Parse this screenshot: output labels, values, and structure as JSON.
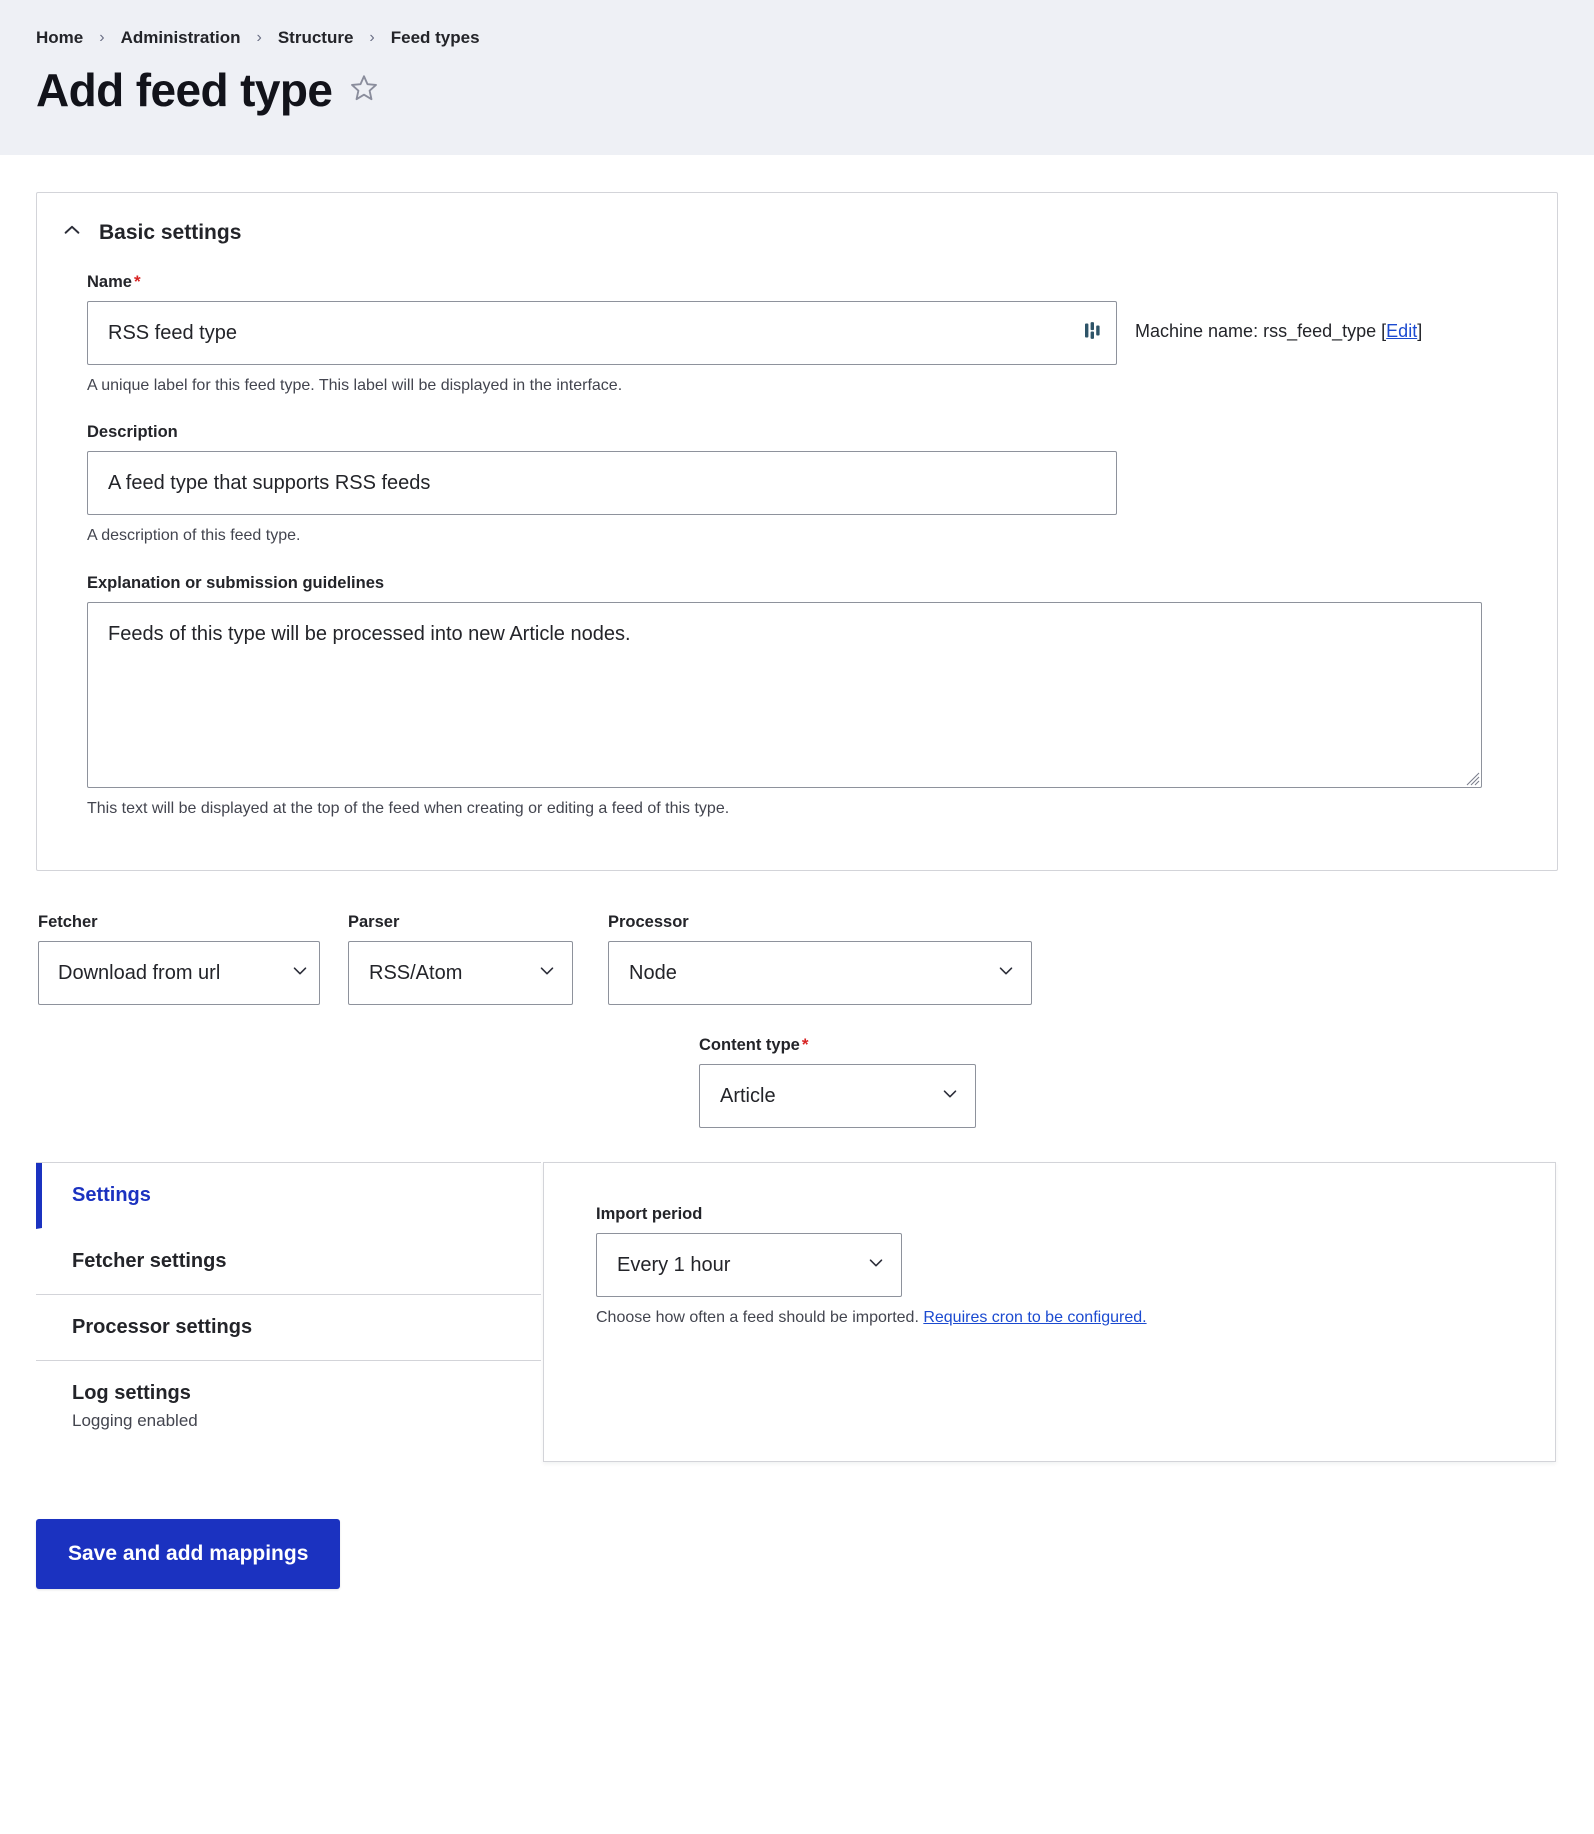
{
  "header": {
    "breadcrumb": [
      {
        "label": "Home"
      },
      {
        "label": "Administration"
      },
      {
        "label": "Structure"
      },
      {
        "label": "Feed types"
      }
    ],
    "separator": "›",
    "title": "Add feed type",
    "star_icon": "star-outline-icon"
  },
  "basic_settings": {
    "legend": "Basic settings",
    "collapse_icon": "chevron-up-icon",
    "name": {
      "label": "Name",
      "required_marker": "*",
      "value": "RSS feed type",
      "placeholder": "",
      "icon": "machine-name-icon",
      "description": "A unique label for this feed type. This label will be displayed in the interface.",
      "machine_name_prefix": "Machine name: ",
      "machine_name_value": "rss_feed_type",
      "machine_name_edit_open": " [",
      "machine_name_edit": "Edit",
      "machine_name_edit_close": "]"
    },
    "description": {
      "label": "Description",
      "value": "A feed type that supports RSS feeds",
      "placeholder": "",
      "help": "A description of this feed type."
    },
    "guidelines": {
      "label": "Explanation or submission guidelines",
      "value": "Feeds of this type will be processed into new Article nodes.",
      "placeholder": "",
      "help": "This text will be displayed at the top of the feed when creating or editing a feed of this type.",
      "resize_handle": "resize-grip-icon"
    }
  },
  "plugins": {
    "fetcher": {
      "label": "Fetcher",
      "value": "Download from url",
      "caret_icon": "chevron-down-icon"
    },
    "parser": {
      "label": "Parser",
      "value": "RSS/Atom",
      "caret_icon": "chevron-down-icon"
    },
    "processor": {
      "label": "Processor",
      "value": "Node",
      "caret_icon": "chevron-down-icon"
    },
    "content_type": {
      "label": "Content type",
      "required_marker": "*",
      "value": "Article",
      "caret_icon": "chevron-down-icon"
    }
  },
  "vertical_tabs": {
    "items": [
      {
        "title": "Settings",
        "summary": "",
        "active": true
      },
      {
        "title": "Fetcher settings",
        "summary": "",
        "active": false
      },
      {
        "title": "Processor settings",
        "summary": "",
        "active": false
      },
      {
        "title": "Log settings",
        "summary": "Logging enabled",
        "active": false
      }
    ],
    "panel": {
      "import_period": {
        "label": "Import period",
        "value": "Every 1 hour",
        "caret_icon": "chevron-down-icon",
        "help_text": "Choose how often a feed should be imported. ",
        "help_link": "Requires cron to be configured."
      }
    }
  },
  "actions": {
    "save_label": "Save and add mappings"
  },
  "colors": {
    "accent_blue": "#1b32c0",
    "link_blue": "#1b4ad0",
    "required_red": "#d72222",
    "header_bg": "#eef0f5",
    "border_grey": "#d3d4d9",
    "input_border": "#8e929c"
  }
}
